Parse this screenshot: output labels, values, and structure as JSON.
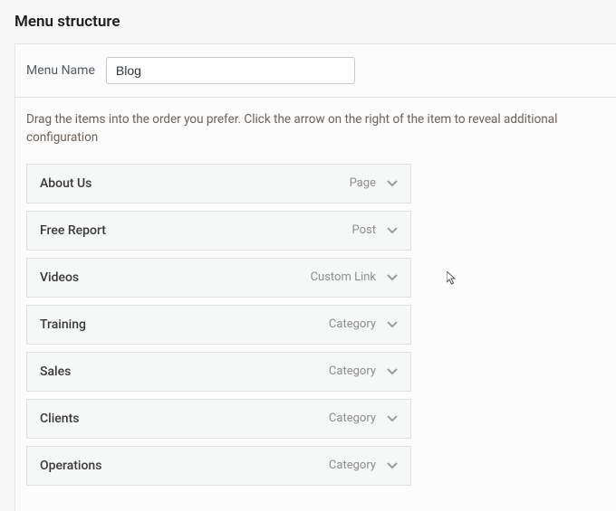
{
  "section_title": "Menu structure",
  "name_row": {
    "label": "Menu Name",
    "value": "Blog"
  },
  "instruction": "Drag the items into the order you prefer. Click the arrow on the right of the item to reveal additional configuration",
  "items": [
    {
      "title": "About Us",
      "type": "Page"
    },
    {
      "title": "Free Report",
      "type": "Post"
    },
    {
      "title": "Videos",
      "type": "Custom Link"
    },
    {
      "title": "Training",
      "type": "Category"
    },
    {
      "title": "Sales",
      "type": "Category"
    },
    {
      "title": "Clients",
      "type": "Category"
    },
    {
      "title": "Operations",
      "type": "Category"
    }
  ]
}
